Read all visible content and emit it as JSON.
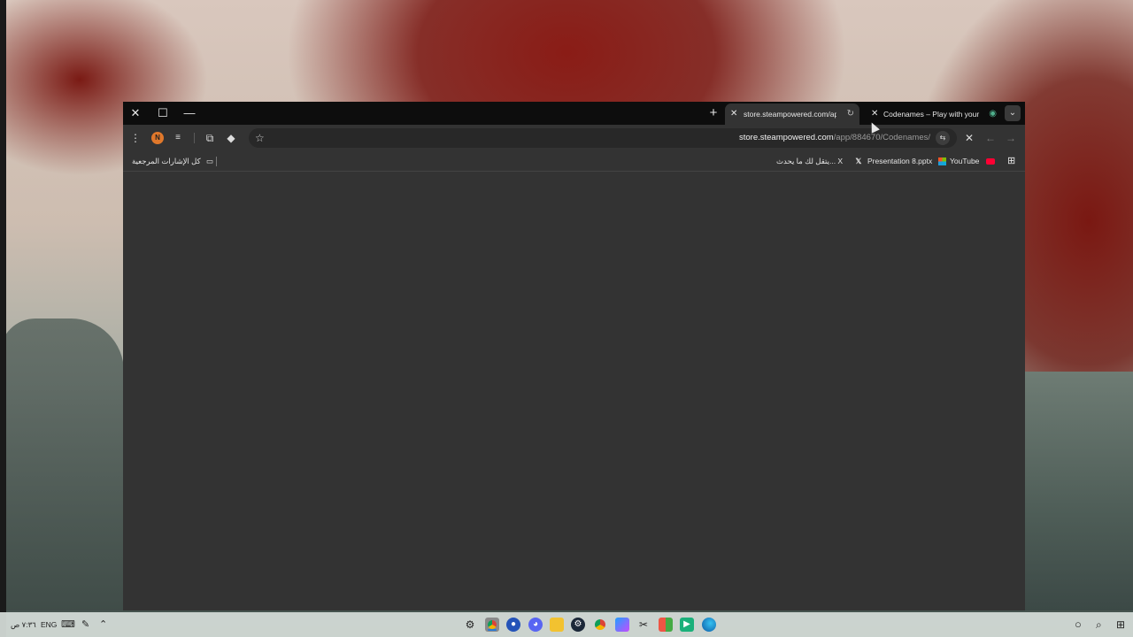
{
  "window": {
    "controls": {
      "close": "✕",
      "maximize": "☐",
      "minimize": "—"
    },
    "new_tab_symbol": "+",
    "tabs": [
      {
        "title": "store.steampowered.com/app/",
        "active": true,
        "close": "✕"
      },
      {
        "title": "Codenames – Play with your Fr",
        "active": false,
        "close": "✕"
      }
    ],
    "tab_menu_symbol": "⌄"
  },
  "toolbar": {
    "menu_symbol": "⋮",
    "profile_initial": "N",
    "url_host": "store.steampowered.com",
    "url_path": "/app/884670/Codenames/",
    "stop_symbol": "✕",
    "back_symbol": "←",
    "forward_symbol": "→"
  },
  "bookmarks": {
    "all_bookmarks": "كل الإشارات المرجعية",
    "items": [
      {
        "label": "يتقل لك ما يحدث... X",
        "icon": "x-logo"
      },
      {
        "label": "Presentation 8.pptx",
        "icon": "microsoft-logo"
      },
      {
        "label": "YouTube",
        "icon": "youtube-logo"
      }
    ]
  },
  "taskbar": {
    "time": "٧:٣٦ ص",
    "language": "ENG",
    "icons": [
      "settings",
      "chrome",
      "shield",
      "discord",
      "files",
      "steam",
      "chrome",
      "copilot",
      "app",
      "grid-app",
      "spotify-app",
      "edge"
    ]
  },
  "colors": {
    "active_tab": "#333333",
    "titlebar": "#0d0d0d",
    "accent": "#2a7bd6"
  }
}
